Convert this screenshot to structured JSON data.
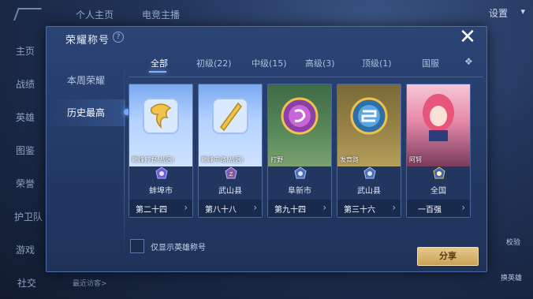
{
  "background": {
    "top_tabs": [
      "个人主页",
      "电竞主播"
    ],
    "settings_label": "设置",
    "nav_items": [
      "主页",
      "战绩",
      "英雄",
      "图鉴",
      "荣誉",
      "护卫队",
      "游戏",
      "社交"
    ],
    "recent_visitors_label": "最近访客>",
    "switch_hero_label": "换英雄",
    "check_label": "校验"
  },
  "modal": {
    "title": "荣耀称号",
    "left_tabs": [
      {
        "label": "本周荣耀",
        "active": false
      },
      {
        "label": "历史最高",
        "active": true
      }
    ],
    "tabs": [
      {
        "label": "全部",
        "active": true
      },
      {
        "label": "初级(22)",
        "active": false
      },
      {
        "label": "中级(15)",
        "active": false
      },
      {
        "label": "高级(3)",
        "active": false
      },
      {
        "label": "顶级(1)",
        "active": false
      },
      {
        "label": "国服",
        "active": false
      }
    ],
    "cards": [
      {
        "name": "巅峰打野(战区)",
        "region": "蚌埠市",
        "rank": "第二十四",
        "style": "blue"
      },
      {
        "name": "巅峰中路(战区)",
        "region": "武山县",
        "rank": "第八十八",
        "style": "blue"
      },
      {
        "name": "打野",
        "region": "阜新市",
        "rank": "第九十四",
        "style": "green"
      },
      {
        "name": "发育路",
        "region": "武山县",
        "rank": "第三十六",
        "style": "olive"
      },
      {
        "name": "阿轲",
        "region": "全国",
        "rank": "一百强",
        "style": "hero"
      }
    ],
    "only_hero_titles_label": "仅显示英雄称号",
    "share_label": "分享"
  },
  "colors": {
    "modal_bg": "#2b4474",
    "accent": "#7fb0ff",
    "share_gold": "#e6c98a"
  }
}
